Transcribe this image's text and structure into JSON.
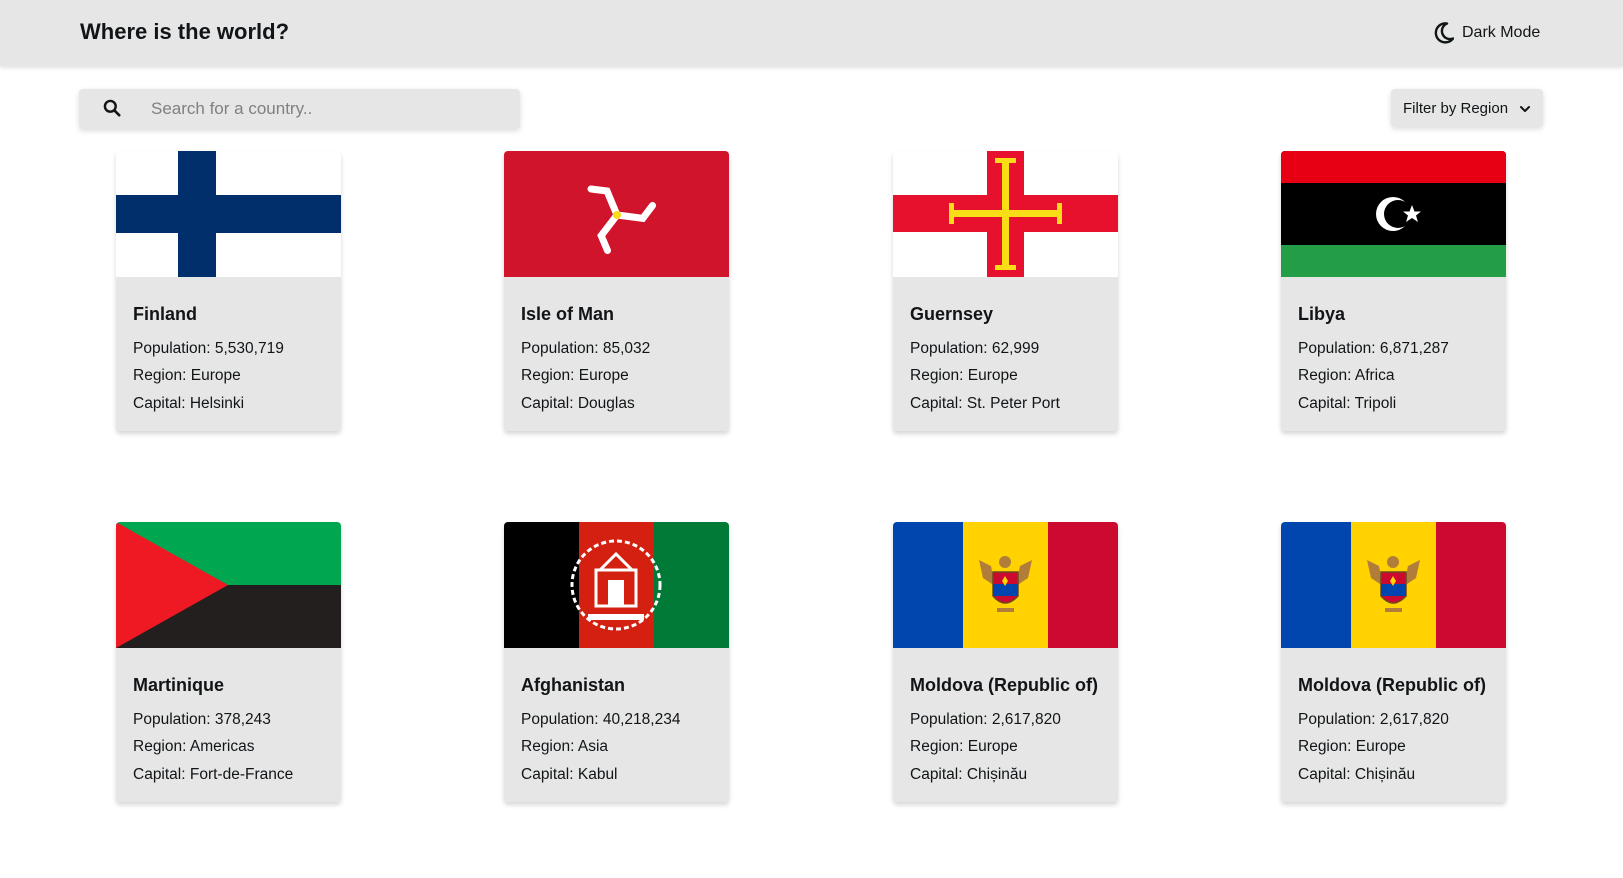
{
  "header": {
    "title": "Where is the world?",
    "dark_mode_label": "Dark Mode",
    "dark_mode_icon": "moon-icon"
  },
  "search": {
    "placeholder": "Search for a country..",
    "value": "",
    "icon": "search-icon"
  },
  "filter": {
    "label": "Filter by Region",
    "icon": "chevron-down-icon"
  },
  "countries": [
    {
      "name": "Finland",
      "population_label": "Population: 5,530,719",
      "region_label": "Region: Europe",
      "capital_label": "Capital: Helsinki",
      "flag_icon": "finland-flag-icon",
      "colors": [
        "#ffffff",
        "#002f6c"
      ]
    },
    {
      "name": "Isle of Man",
      "population_label": "Population: 85,032",
      "region_label": "Region: Europe",
      "capital_label": "Capital: Douglas",
      "flag_icon": "isle-of-man-flag-icon",
      "colors": [
        "#cf142b",
        "#ffffff",
        "#f9dd16"
      ]
    },
    {
      "name": "Guernsey",
      "population_label": "Population: 62,999",
      "region_label": "Region: Europe",
      "capital_label": "Capital: St. Peter Port",
      "flag_icon": "guernsey-flag-icon",
      "colors": [
        "#ffffff",
        "#e8112d",
        "#f9dd16"
      ]
    },
    {
      "name": "Libya",
      "population_label": "Population: 6,871,287",
      "region_label": "Region: Africa",
      "capital_label": "Capital: Tripoli",
      "flag_icon": "libya-flag-icon",
      "colors": [
        "#e70013",
        "#000000",
        "#239e46",
        "#ffffff"
      ]
    },
    {
      "name": "Martinique",
      "population_label": "Population: 378,243",
      "region_label": "Region: Americas",
      "capital_label": "Capital: Fort-de-France",
      "flag_icon": "martinique-flag-icon",
      "colors": [
        "#00a650",
        "#231f1e",
        "#ef1923"
      ]
    },
    {
      "name": "Afghanistan",
      "population_label": "Population: 40,218,234",
      "region_label": "Region: Asia",
      "capital_label": "Capital: Kabul",
      "flag_icon": "afghanistan-flag-icon",
      "colors": [
        "#000000",
        "#d32011",
        "#007a36",
        "#ffffff"
      ]
    },
    {
      "name": "Moldova (Republic of)",
      "population_label": "Population: 2,617,820",
      "region_label": "Region: Europe",
      "capital_label": "Capital: Chișinău",
      "flag_icon": "moldova-flag-icon",
      "colors": [
        "#0046ae",
        "#ffd200",
        "#cc092f",
        "#b07e3a"
      ]
    },
    {
      "name": "Moldova (Republic of)",
      "population_label": "Population: 2,617,820",
      "region_label": "Region: Europe",
      "capital_label": "Capital: Chișinău",
      "flag_icon": "moldova-flag-icon",
      "colors": [
        "#0046ae",
        "#ffd200",
        "#cc092f",
        "#b07e3a"
      ]
    }
  ]
}
